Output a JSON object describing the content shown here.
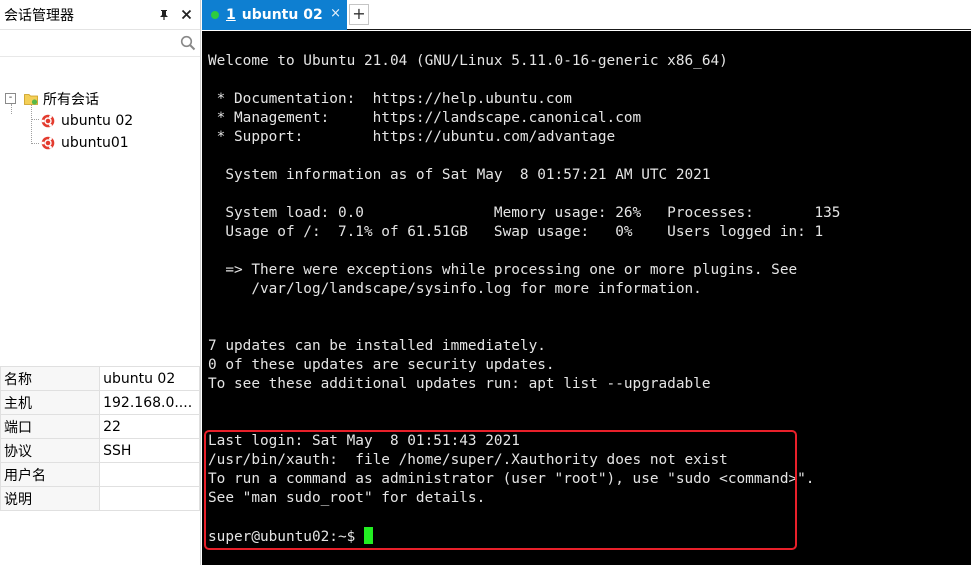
{
  "left_panel": {
    "title": "会话管理器",
    "pin_icon": "pin-icon",
    "close_icon": "close-icon",
    "search": {
      "placeholder": "",
      "value": ""
    },
    "tree": {
      "toggle": "-",
      "root_label": "所有会话",
      "sessions": [
        {
          "label": "ubuntu 02"
        },
        {
          "label": "ubuntu01"
        }
      ]
    },
    "properties": [
      {
        "key": "名称",
        "value": "ubuntu 02"
      },
      {
        "key": "主机",
        "value": "192.168.0...."
      },
      {
        "key": "端口",
        "value": "22"
      },
      {
        "key": "协议",
        "value": "SSH"
      },
      {
        "key": "用户名",
        "value": ""
      },
      {
        "key": "说明",
        "value": ""
      }
    ]
  },
  "tabs": {
    "active": {
      "number": "1",
      "label": "ubuntu 02",
      "status_color": "#2ecc40"
    },
    "close_symbol": "×",
    "add_symbol": "+"
  },
  "terminal": {
    "lines": [
      "Welcome to Ubuntu 21.04 (GNU/Linux 5.11.0-16-generic x86_64)",
      "",
      " * Documentation:  https://help.ubuntu.com",
      " * Management:     https://landscape.canonical.com",
      " * Support:        https://ubuntu.com/advantage",
      "",
      "  System information as of Sat May  8 01:57:21 AM UTC 2021",
      "",
      "  System load: 0.0               Memory usage: 26%   Processes:       135",
      "  Usage of /:  7.1% of 61.51GB   Swap usage:   0%    Users logged in: 1",
      "",
      "  => There were exceptions while processing one or more plugins. See",
      "     /var/log/landscape/sysinfo.log for more information.",
      "",
      "",
      "7 updates can be installed immediately.",
      "0 of these updates are security updates.",
      "To see these additional updates run: apt list --upgradable",
      "",
      "",
      "Last login: Sat May  8 01:51:43 2021",
      "/usr/bin/xauth:  file /home/super/.Xauthority does not exist",
      "To run a command as administrator (user \"root\"), use \"sudo <command>\".",
      "See \"man sudo_root\" for details.",
      ""
    ],
    "prompt": "super@ubuntu02:~$ ",
    "cursor_color": "#22ee22",
    "highlight_color": "#e8202a"
  }
}
